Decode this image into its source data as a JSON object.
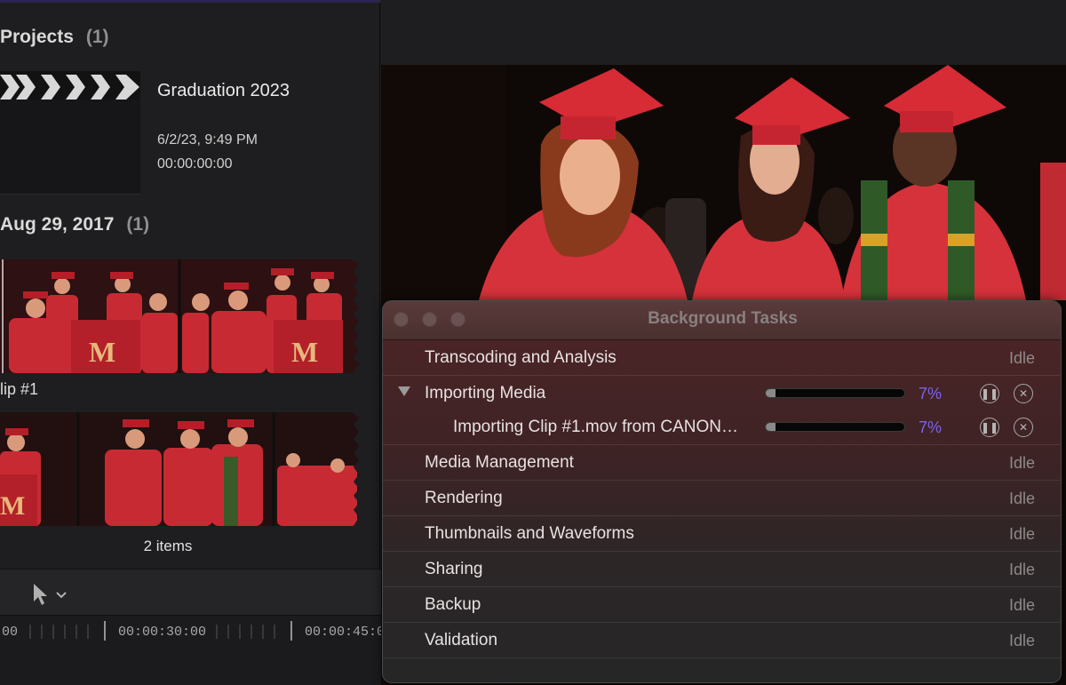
{
  "browser": {
    "projects_heading": "Projects",
    "projects_count": "(1)",
    "project": {
      "title": "Graduation 2023",
      "date": "6/2/23, 9:49 PM",
      "duration": "00:00:00:00"
    },
    "event_heading": "Aug 29, 2017",
    "event_count": "(1)",
    "clip_label": "lip #1",
    "footer_count": "2 items"
  },
  "toolbar": {
    "tool_icon": "pointer-arrow-icon",
    "dropdown_icon": "chevron-down-icon"
  },
  "timeline": {
    "timecodes": [
      "00",
      "00:00:30:00",
      "00:00:45:0"
    ]
  },
  "background_tasks": {
    "title": "Background Tasks",
    "accent_color": "#7b62f0",
    "tasks": [
      {
        "label": "Transcoding and Analysis",
        "status": "Idle"
      },
      {
        "label": "Importing Media",
        "progress": "7%",
        "progress_value": 0.07,
        "expanded": true
      },
      {
        "label": "Importing Clip #1.mov from CANON…",
        "progress": "7%",
        "progress_value": 0.07
      },
      {
        "label": "Media Management",
        "status": "Idle"
      },
      {
        "label": "Rendering",
        "status": "Idle"
      },
      {
        "label": "Thumbnails and Waveforms",
        "status": "Idle"
      },
      {
        "label": "Sharing",
        "status": "Idle"
      },
      {
        "label": "Backup",
        "status": "Idle"
      },
      {
        "label": "Validation",
        "status": "Idle"
      }
    ],
    "pause_icon": "pause-icon",
    "cancel_icon": "cancel-icon"
  }
}
